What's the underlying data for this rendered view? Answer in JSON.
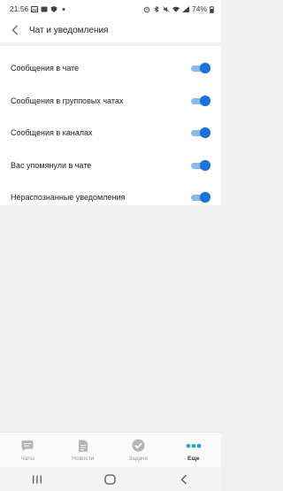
{
  "status_bar": {
    "time": "21:56",
    "battery": "74%",
    "icons_left": [
      "image-icon",
      "notification-icon",
      "shield-icon",
      "dot-icon"
    ],
    "icons_right": [
      "alarm-icon",
      "bluetooth-icon",
      "mute-icon",
      "wifi-icon",
      "signal-icon"
    ]
  },
  "header": {
    "title": "Чат и уведомления",
    "back_icon": "chevron-left-icon"
  },
  "settings": [
    {
      "label": "Сообщения в чате",
      "enabled": true
    },
    {
      "label": "Сообщения в групповых чатах",
      "enabled": true
    },
    {
      "label": "Сообщения в каналах",
      "enabled": true
    },
    {
      "label": "Вас упомянули в чате",
      "enabled": true
    },
    {
      "label": "Нераспознанные уведомления",
      "enabled": true
    }
  ],
  "tabs": [
    {
      "label": "Чаты",
      "icon": "chat-icon",
      "active": false
    },
    {
      "label": "Новости",
      "icon": "news-icon",
      "active": false
    },
    {
      "label": "Задачи",
      "icon": "check-icon",
      "active": false
    },
    {
      "label": "Еще",
      "icon": "more-icon",
      "active": true
    }
  ],
  "nav": [
    "recent-apps-icon",
    "home-icon",
    "back-icon"
  ],
  "colors": {
    "accent": "#1a73d9",
    "toggle_track": "#8ab9e8",
    "more_dots": "#1fa8b8",
    "tab_icon_inactive": "#b5b5b5"
  }
}
